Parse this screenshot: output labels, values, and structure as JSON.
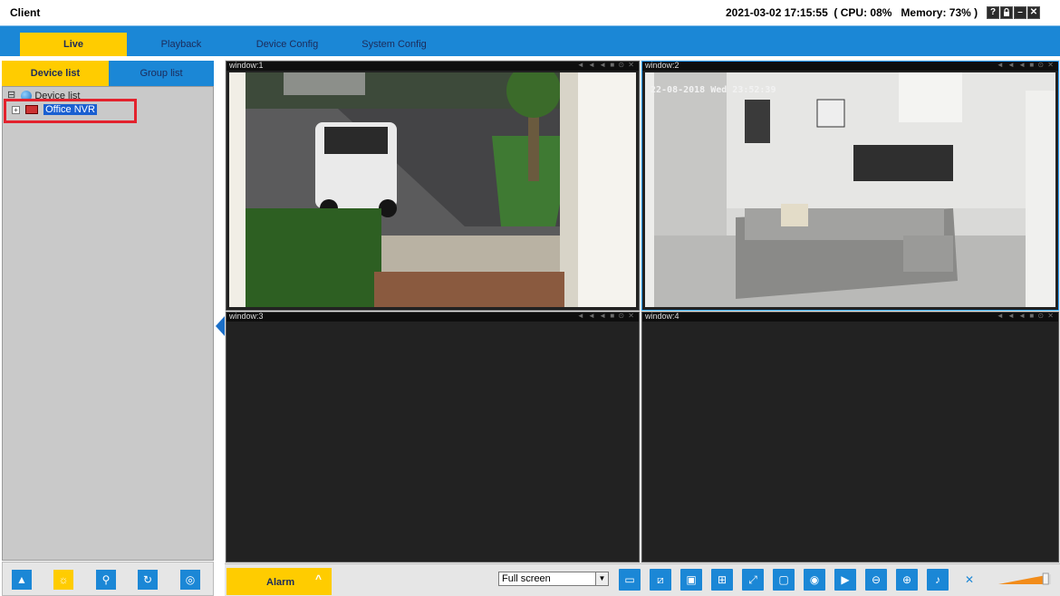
{
  "titlebar": {
    "app_title": "Client",
    "status": "2021-03-02 17:15:55  ( CPU: 08%   Memory: 73% )",
    "controls": [
      "help-icon",
      "lock-icon",
      "minimize-icon",
      "close-icon"
    ],
    "control_glyphs": [
      "?",
      "🔒",
      "–",
      "✕"
    ]
  },
  "main_tabs": [
    {
      "label": "Live",
      "active": true
    },
    {
      "label": "Playback",
      "active": false
    },
    {
      "label": "Device Config",
      "active": false
    },
    {
      "label": "System Config",
      "active": false
    }
  ],
  "sidebar": {
    "tabs": [
      {
        "label": "Device list",
        "active": true
      },
      {
        "label": "Group list",
        "active": false
      }
    ],
    "tree": {
      "root_label": "Device list",
      "root_expander": "⊟",
      "node_expander": "+",
      "node_label": "Office NVR"
    },
    "bottom_buttons": [
      {
        "icon": "up-arrow-icon",
        "glyph": "▲",
        "active": false
      },
      {
        "icon": "sun-icon",
        "glyph": "☼",
        "active": true
      },
      {
        "icon": "pin-icon",
        "glyph": "⚲",
        "active": false
      },
      {
        "icon": "refresh-icon",
        "glyph": "↻",
        "active": false
      },
      {
        "icon": "target-icon",
        "glyph": "◎",
        "active": false
      }
    ]
  },
  "windows": [
    {
      "title": "window:1",
      "ctrls": "◄ ◄ ◄ ■ ⊙ ✕",
      "feed": "parking-lot"
    },
    {
      "title": "window:2",
      "ctrls": "◄ ◄ ◄ ■ ⊙ ✕",
      "feed": "living-room",
      "overlay": "22-08-2018  Wed  23:52:39"
    },
    {
      "title": "window:3",
      "ctrls": "◄ ◄ ◄ ■ ⊙ ✕",
      "feed": "empty"
    },
    {
      "title": "window:4",
      "ctrls": "◄ ◄ ◄ ■ ⊙ ✕",
      "feed": "empty"
    }
  ],
  "toolbar": {
    "alarm_label": "Alarm",
    "alarm_chevron": "^",
    "layout_value": "Full screen",
    "layout_arrow": "▼",
    "buttons": [
      {
        "icon": "camera-stream-icon",
        "glyph": "▭"
      },
      {
        "icon": "camera-off-icon",
        "glyph": "⧄"
      },
      {
        "icon": "record-window-icon",
        "glyph": "▣"
      },
      {
        "icon": "grid-layout-icon",
        "glyph": "⊞"
      },
      {
        "icon": "fullscreen-icon",
        "glyph": "⤢"
      },
      {
        "icon": "window-icon",
        "glyph": "▢"
      },
      {
        "icon": "snapshot-icon",
        "glyph": "◉"
      },
      {
        "icon": "video-record-icon",
        "glyph": "▶"
      },
      {
        "icon": "zoom-out-icon",
        "glyph": "⊖"
      },
      {
        "icon": "zoom-in-icon",
        "glyph": "⊕"
      },
      {
        "icon": "microphone-icon",
        "glyph": "♪"
      },
      {
        "icon": "mute-icon",
        "glyph": "✕"
      }
    ],
    "volume_level": 0.9
  },
  "colors": {
    "accent_blue": "#1b87d6",
    "accent_yellow": "#ffcc00",
    "highlight_red": "#e3222d",
    "selected_blue": "#1a5fd1"
  }
}
